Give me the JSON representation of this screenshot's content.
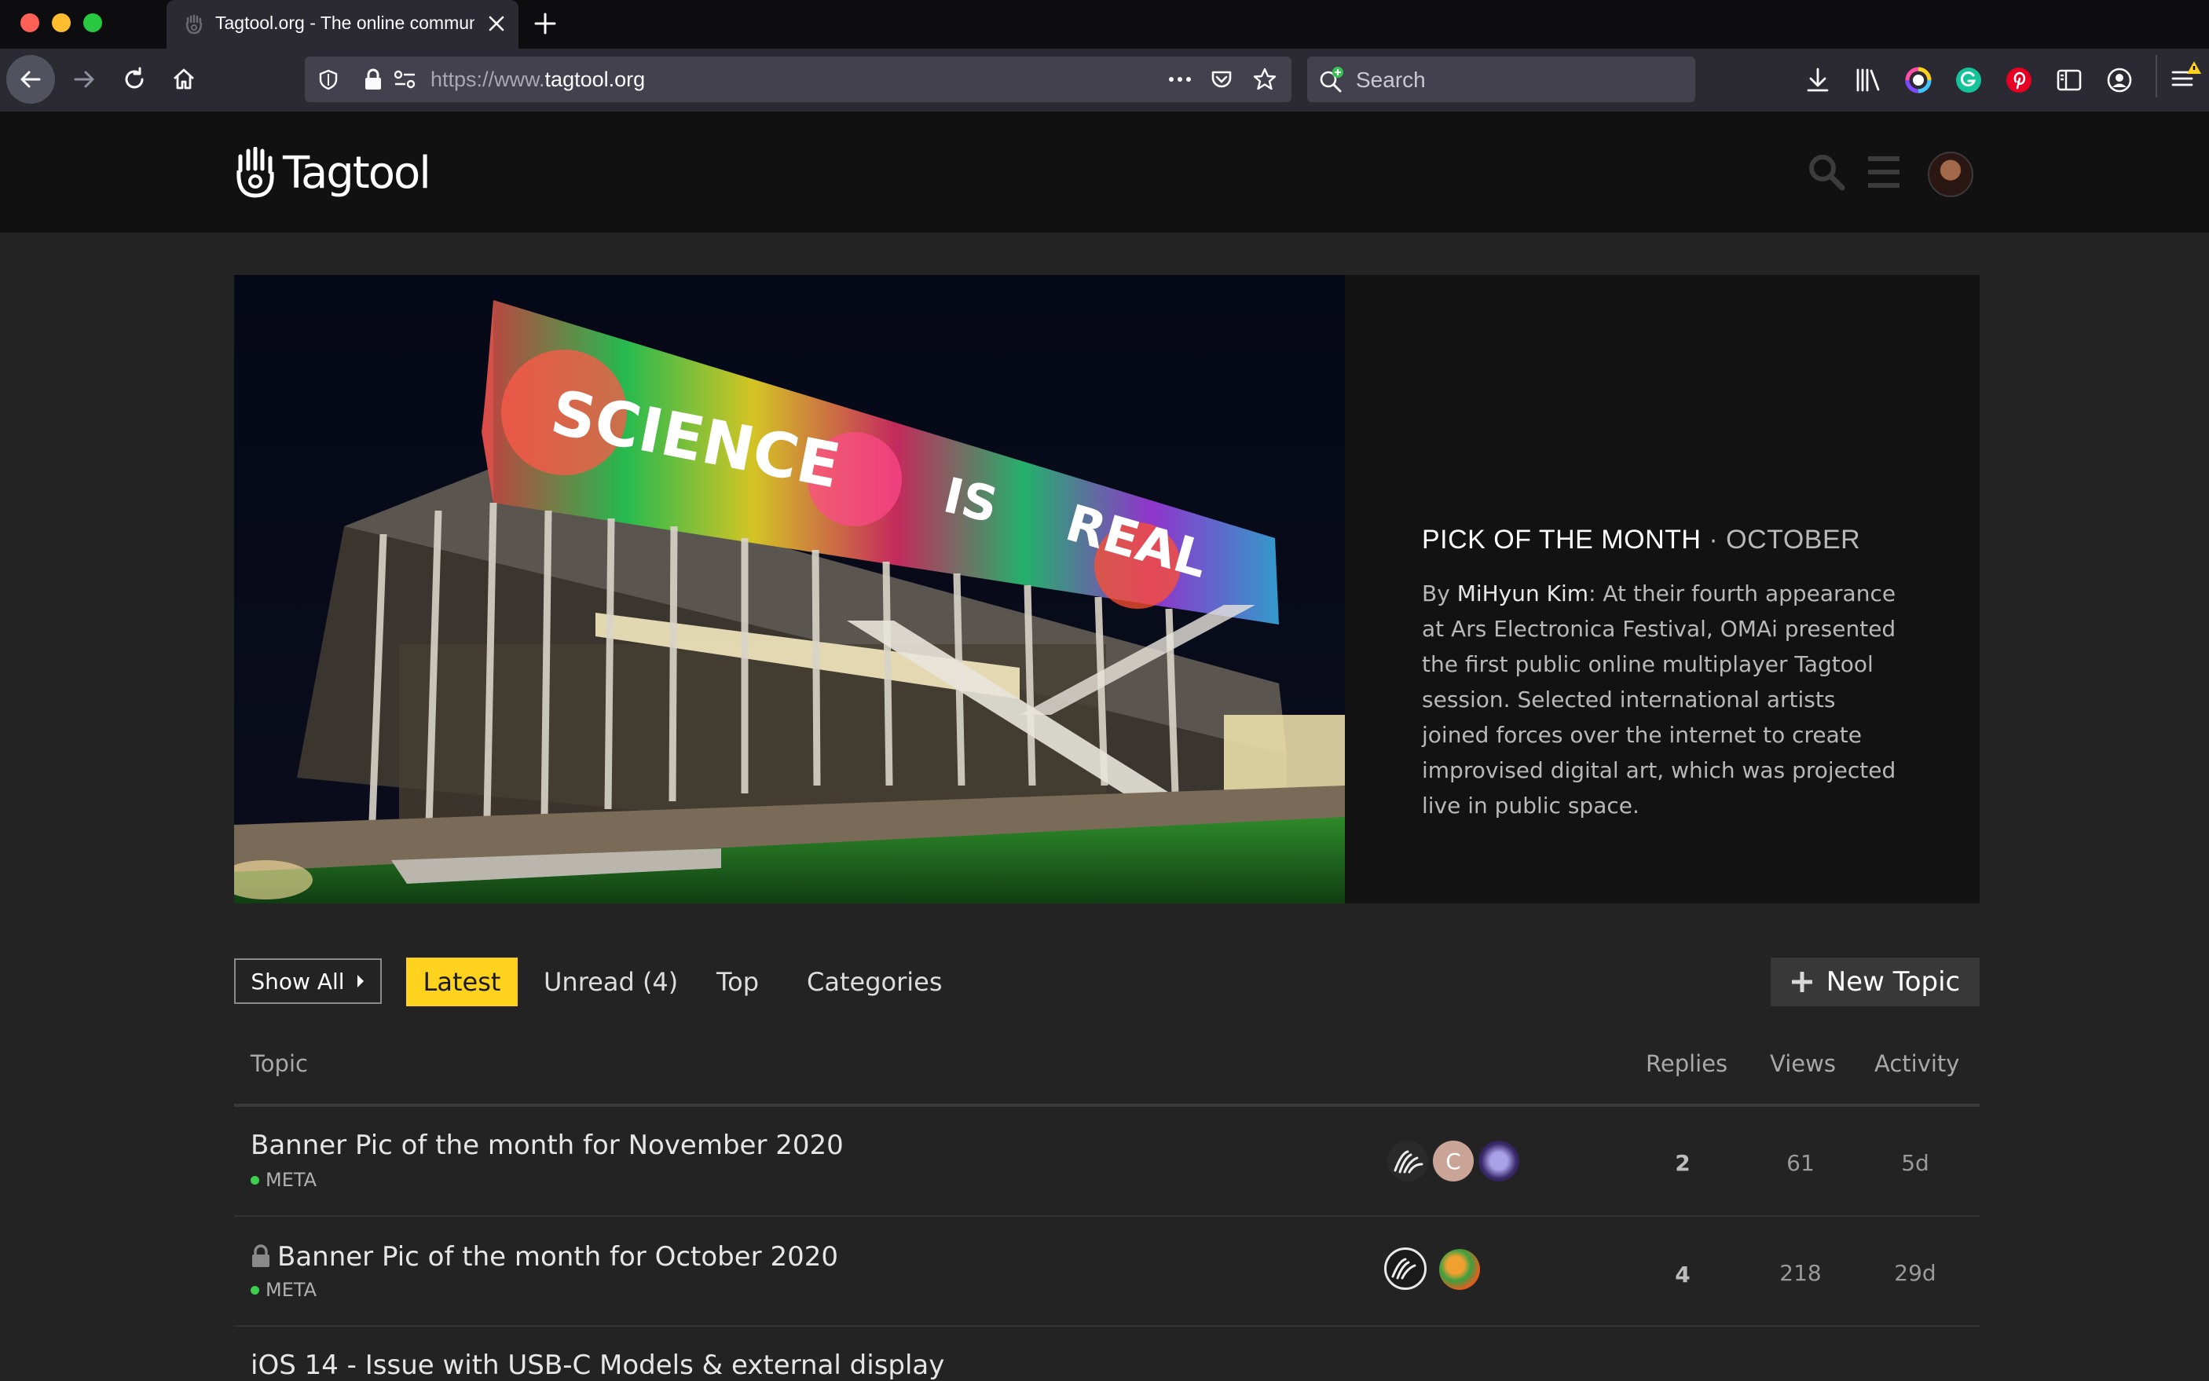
{
  "browser": {
    "tab_title": "Tagtool.org - The online community",
    "url_prefix": "https://www.",
    "url_domain": "tagtool.org",
    "search_placeholder": "Search"
  },
  "site": {
    "logo_text": "Tagtool"
  },
  "banner": {
    "heading": "PICK OF THE MONTH",
    "month": "· OCTOBER",
    "by": "By ",
    "author": "MiHyun Kim",
    "description": ": At their fourth appearance at Ars Electronica Festival, OMAi presented the first public online multiplayer Tagtool session. Selected international artists joined forces over the internet to create improvised digital art, which was projected live in public space.",
    "projection_words": [
      "SCIENCE",
      "IS",
      "REAL"
    ]
  },
  "nav": {
    "show_all": "Show All",
    "latest": "Latest",
    "unread": "Unread (4)",
    "top": "Top",
    "categories": "Categories",
    "new_topic": "New Topic"
  },
  "table": {
    "headers": {
      "topic": "Topic",
      "replies": "Replies",
      "views": "Views",
      "activity": "Activity"
    },
    "rows": [
      {
        "title": "Banner Pic of the month for November 2020",
        "category": "META",
        "replies": "2",
        "views": "61",
        "activity": "5d",
        "locked": false,
        "poster_initial": "C"
      },
      {
        "title": "Banner Pic of the month for October 2020",
        "category": "META",
        "replies": "4",
        "views": "218",
        "activity": "29d",
        "locked": true
      },
      {
        "title": "iOS 14 - Issue with USB-C Models & external display"
      }
    ]
  },
  "colors": {
    "accent_yellow": "#ffd21e",
    "category_meta": "#3ccf4e",
    "background": "#232323"
  }
}
